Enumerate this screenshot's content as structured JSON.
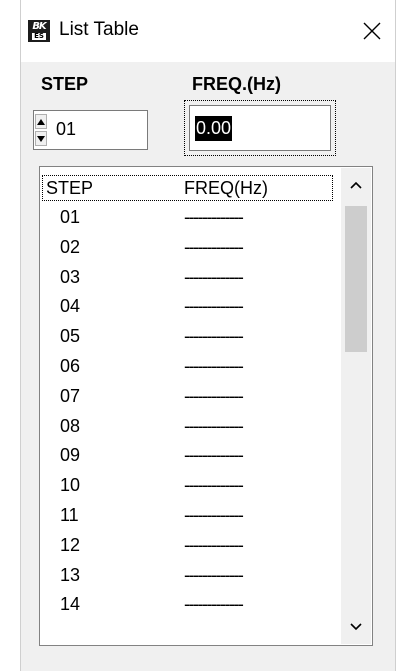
{
  "window": {
    "title": "List Table",
    "icon": {
      "name": "bk-precision-icon",
      "top": "BK",
      "bottom": "ES"
    }
  },
  "labels": {
    "step": "STEP",
    "freq": "FREQ.(Hz)"
  },
  "step_spinner": {
    "value": "01"
  },
  "freq_input": {
    "value": "0.00"
  },
  "list": {
    "header": {
      "step": "STEP",
      "freq": "FREQ(Hz)"
    },
    "rows": [
      {
        "step": "01",
        "freq": "-------------"
      },
      {
        "step": "02",
        "freq": "-------------"
      },
      {
        "step": "03",
        "freq": "-------------"
      },
      {
        "step": "04",
        "freq": "-------------"
      },
      {
        "step": "05",
        "freq": "-------------"
      },
      {
        "step": "06",
        "freq": "-------------"
      },
      {
        "step": "07",
        "freq": "-------------"
      },
      {
        "step": "08",
        "freq": "-------------"
      },
      {
        "step": "09",
        "freq": "-------------"
      },
      {
        "step": "10",
        "freq": "-------------"
      },
      {
        "step": "11",
        "freq": "-------------"
      },
      {
        "step": "12",
        "freq": "-------------"
      },
      {
        "step": "13",
        "freq": "-------------"
      },
      {
        "step": "14",
        "freq": "-------------"
      }
    ]
  },
  "colors": {
    "window_bg": "#f0f0f0",
    "selection_bg": "#000000",
    "scroll_thumb": "#cdcdcd"
  }
}
